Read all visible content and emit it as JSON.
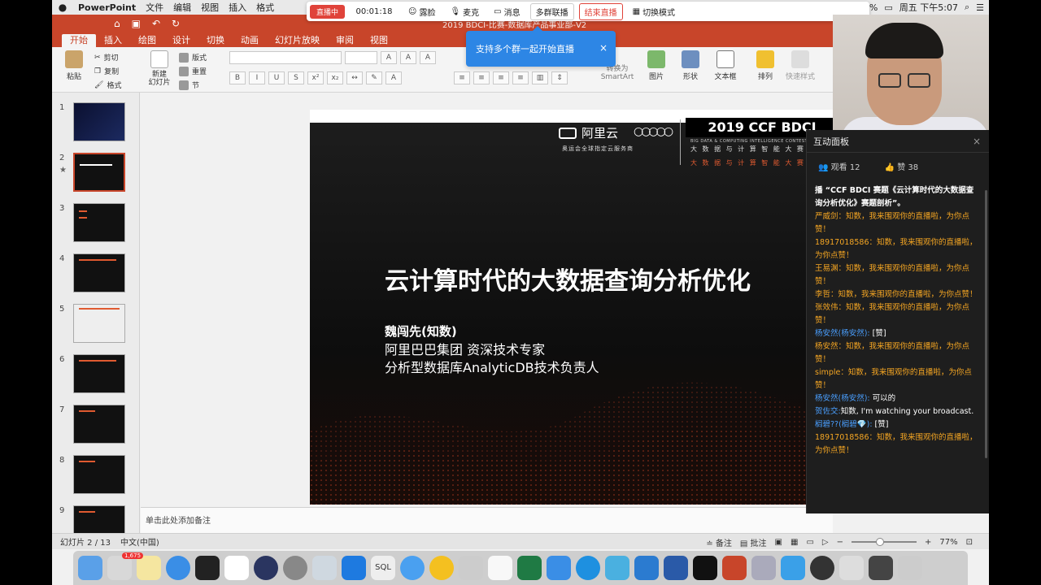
{
  "menubar": {
    "apple": "",
    "items": [
      "PowerPoint",
      "文件",
      "编辑",
      "视图",
      "插入",
      "格式"
    ],
    "battery": "37%",
    "clock": "周五 下午5:07"
  },
  "livebar": {
    "status": "直播中",
    "timer": "00:01:18",
    "beauty": "露脸",
    "mic": "麦克",
    "message": "消息",
    "multi_group": "多群联播",
    "end": "结束直播",
    "switch_mode": "切换模式"
  },
  "title_doc": "2019 BDCI-比赛-数据库产品事业部-V2",
  "ribbon_tabs": [
    "开始",
    "插入",
    "绘图",
    "设计",
    "切换",
    "动画",
    "幻灯片放映",
    "审阅",
    "视图"
  ],
  "ribbon": {
    "paste": "粘贴",
    "cut": "剪切",
    "copy": "复制",
    "format": "格式",
    "new_slide": "新建\n幻灯片",
    "layout": "版式",
    "reset": "重置",
    "section": "节",
    "smartart": "转换为\nSmartArt",
    "picture": "图片",
    "shape": "形状",
    "textbox": "文本框",
    "arrange": "排列",
    "quick_style": "快速样式"
  },
  "toast": {
    "text": "支持多个群一起开始直播",
    "close": "×"
  },
  "thumbnails": [
    {
      "num": "1",
      "star": ""
    },
    {
      "num": "2",
      "star": "★"
    },
    {
      "num": "3",
      "star": ""
    },
    {
      "num": "4",
      "star": ""
    },
    {
      "num": "5",
      "star": ""
    },
    {
      "num": "6",
      "star": ""
    },
    {
      "num": "7",
      "star": ""
    },
    {
      "num": "8",
      "star": ""
    },
    {
      "num": "9",
      "star": ""
    }
  ],
  "slide": {
    "aliyun": "阿里云",
    "aliyun_sub": "奥运会全球指定云服务商",
    "ccf": "2019 CCF BDCI",
    "ccf_sub": "BIG DATA & COMPUTING INTELLIGENCE CONTEST",
    "ccf_sub2": "大 数 据 与 计 算 智 能 大 赛",
    "ccf_sub3": "大 数 据 与 计 算 智 能 大 赛",
    "title": "云计算时代的大数据查询分析优化",
    "name": "魏闯先(知数)",
    "line2": "阿里巴巴集团 资深技术专家",
    "line3": "分析型数据库AnalyticDB技术负责人"
  },
  "notes_placeholder": "单击此处添加备注",
  "statusbar": {
    "slide_info": "幻灯片 2 / 13",
    "lang": "中文(中国)",
    "notes": "备注",
    "comments": "批注",
    "zoom": "77%"
  },
  "panel": {
    "title": "互动面板",
    "close": "×",
    "viewers": "观看 12",
    "likes": "赞 38",
    "messages": [
      {
        "type": "sys",
        "text": "播 “CCF BDCI 赛题《云计算时代的大数据查询分析优化》赛题剖析”。"
      },
      {
        "type": "orange",
        "text": "严威剑：知数，我来围观你的直播啦，为你点赞！"
      },
      {
        "type": "orange",
        "text": "18917018586：知数，我来围观你的直播啦，为你点赞！"
      },
      {
        "type": "orange",
        "text": "王易渊：知数，我来围观你的直播啦，为你点赞！"
      },
      {
        "type": "orange",
        "text": "李哲：知数，我来围观你的直播啦，为你点赞！"
      },
      {
        "type": "orange",
        "text": "张效伟：知数，我来围观你的直播啦，为你点赞！"
      },
      {
        "type": "blue",
        "who": "杨安然(杨安然):",
        "text": " [赞]"
      },
      {
        "type": "orange",
        "text": "杨安然：知数，我来围观你的直播啦，为你点赞！"
      },
      {
        "type": "orange",
        "text": "simple：知数，我来围观你的直播啦，为你点赞！"
      },
      {
        "type": "blue",
        "who": "杨安然(杨安然):",
        "text": " 可以的"
      },
      {
        "type": "blue",
        "who": "贺佐交:",
        "text": "知数, I'm watching your broadcast."
      },
      {
        "type": "blue",
        "who": "榈碧??(榈碧💎):",
        "text": " [赞]"
      },
      {
        "type": "orange",
        "text": "18917018586：知数，我来围观你的直播啦，为你点赞！"
      }
    ]
  },
  "dock": {
    "badge": "1,675",
    "sql_label": "SQL"
  }
}
